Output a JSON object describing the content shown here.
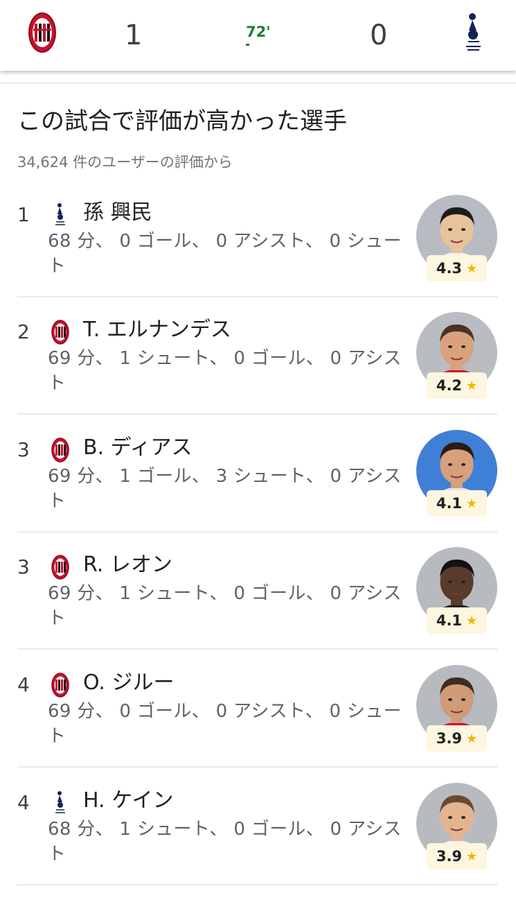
{
  "scoreboard": {
    "home_score": "1",
    "away_score": "0",
    "minute": "72'",
    "home_team_icon": "ac-milan-crest",
    "away_team_icon": "tottenham-cockerel",
    "accent_color": "#188038"
  },
  "section": {
    "title": "この試合で評価が高かった選手",
    "subtitle": "34,624 件のユーザーの評価から"
  },
  "players": [
    {
      "rank": "1",
      "team": "tottenham",
      "name": "孫 興民",
      "stats": "68 分、 0 ゴール、 0 アシスト、 0 シュート",
      "rating": "4.3",
      "avatar_bg": "#b8bcc2",
      "skin": "#e8c29a",
      "hair": "#1c1c1c",
      "shirt": "#eef0f3"
    },
    {
      "rank": "2",
      "team": "milan",
      "name": "T. エルナンデス",
      "stats": "69 分、 1 シュート、 0 ゴール、 0 アシスト",
      "rating": "4.2",
      "avatar_bg": "#b9bcc1",
      "skin": "#d9a27d",
      "hair": "#4a3326",
      "shirt": "#c8102e"
    },
    {
      "rank": "3",
      "team": "milan",
      "name": "B. ディアス",
      "stats": "69 分、 1 ゴール、 3 シュート、 0 アシスト",
      "rating": "4.1",
      "avatar_bg": "#3f80d6",
      "skin": "#d6a07c",
      "hair": "#2a1c14",
      "shirt": "#e3e6ea"
    },
    {
      "rank": "3",
      "team": "milan",
      "name": "R. レオン",
      "stats": "69 分、 1 シュート、 0 ゴール、 0 アシスト",
      "rating": "4.1",
      "avatar_bg": "#b7bbc0",
      "skin": "#5a3a28",
      "hair": "#121212",
      "shirt": "#202020"
    },
    {
      "rank": "4",
      "team": "milan",
      "name": "O. ジルー",
      "stats": "69 分、 0 ゴール、 0 アシスト、 0 シュート",
      "rating": "3.9",
      "avatar_bg": "#b7bbc0",
      "skin": "#d19a78",
      "hair": "#3d2d22",
      "shirt": "#c8102e"
    },
    {
      "rank": "4",
      "team": "tottenham",
      "name": "H. ケイン",
      "stats": "68 分、 1 シュート、 0 ゴール、 0 アシスト",
      "rating": "3.9",
      "avatar_bg": "#b7bbc0",
      "skin": "#e4b491",
      "hair": "#6b4a2e",
      "shirt": "#f2f2f2"
    }
  ]
}
